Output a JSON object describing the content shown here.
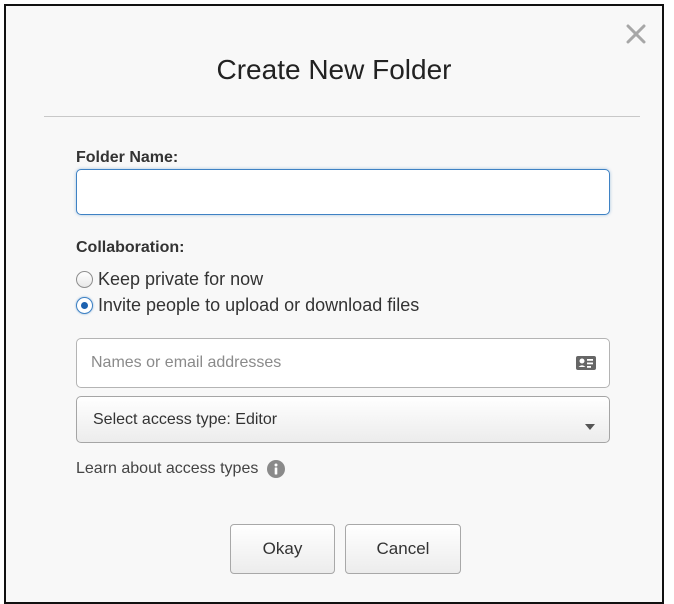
{
  "dialog": {
    "title": "Create New Folder",
    "close_icon": "close-icon"
  },
  "folder_name": {
    "label": "Folder Name:",
    "value": ""
  },
  "collaboration": {
    "label": "Collaboration:",
    "options": [
      {
        "label": "Keep private for now",
        "selected": false
      },
      {
        "label": "Invite people to upload or download files",
        "selected": true
      }
    ]
  },
  "invite": {
    "placeholder": "Names or email addresses",
    "value": "",
    "contact_icon": "contact-card-icon"
  },
  "access": {
    "selected": "Select access type: Editor",
    "caret_icon": "chevron-down-icon"
  },
  "learn": {
    "text": "Learn about access types",
    "info_icon": "info-icon"
  },
  "buttons": {
    "okay": "Okay",
    "cancel": "Cancel"
  },
  "colors": {
    "accent": "#3f82c4",
    "dialog_background": "#f8f8f8",
    "border": "#111111"
  }
}
